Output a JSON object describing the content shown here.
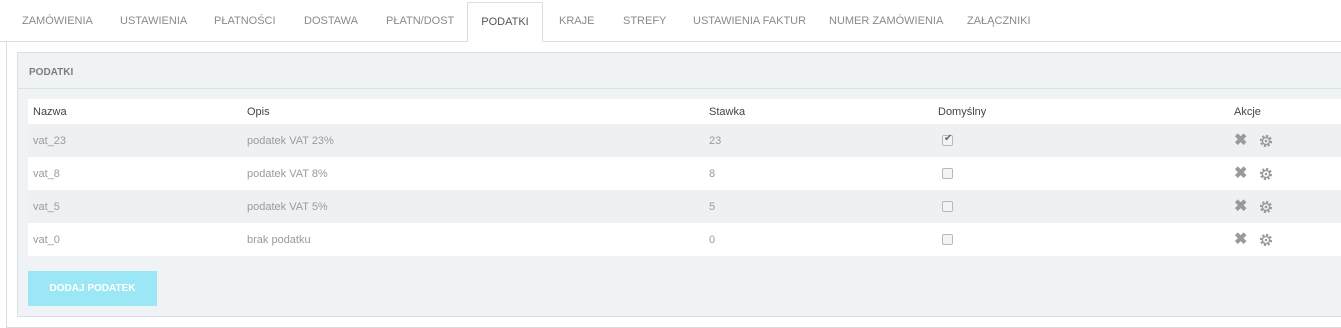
{
  "tabs": [
    {
      "label": "ZAMÓWIENIA"
    },
    {
      "label": "USTAWIENIA"
    },
    {
      "label": "PŁATNOŚCI"
    },
    {
      "label": "DOSTAWA"
    },
    {
      "label": "PŁATN/DOST"
    },
    {
      "label": "PODATKI",
      "active": true
    },
    {
      "label": "KRAJE"
    },
    {
      "label": "STREFY"
    },
    {
      "label": "USTAWIENIA FAKTUR"
    },
    {
      "label": "NUMER ZAMÓWIENIA"
    },
    {
      "label": "ZAŁĄCZNIKI"
    }
  ],
  "panel": {
    "title": "PODATKI"
  },
  "table": {
    "headers": {
      "name": "Nazwa",
      "desc": "Opis",
      "rate": "Stawka",
      "default": "Domyślny",
      "actions": "Akcje"
    },
    "rows": [
      {
        "name": "vat_23",
        "desc": "podatek VAT 23%",
        "rate": "23",
        "default": true
      },
      {
        "name": "vat_8",
        "desc": "podatek VAT 8%",
        "rate": "8",
        "default": false
      },
      {
        "name": "vat_5",
        "desc": "podatek VAT 5%",
        "rate": "5",
        "default": false
      },
      {
        "name": "vat_0",
        "desc": "brak podatku",
        "rate": "0",
        "default": false
      }
    ]
  },
  "add_button": {
    "label": "DODAJ PODATEK"
  },
  "icons": {
    "delete": "close-icon",
    "settings": "gear-icon"
  },
  "colors": {
    "button": "#9be7f5",
    "row_alt": "#eef1f4"
  }
}
